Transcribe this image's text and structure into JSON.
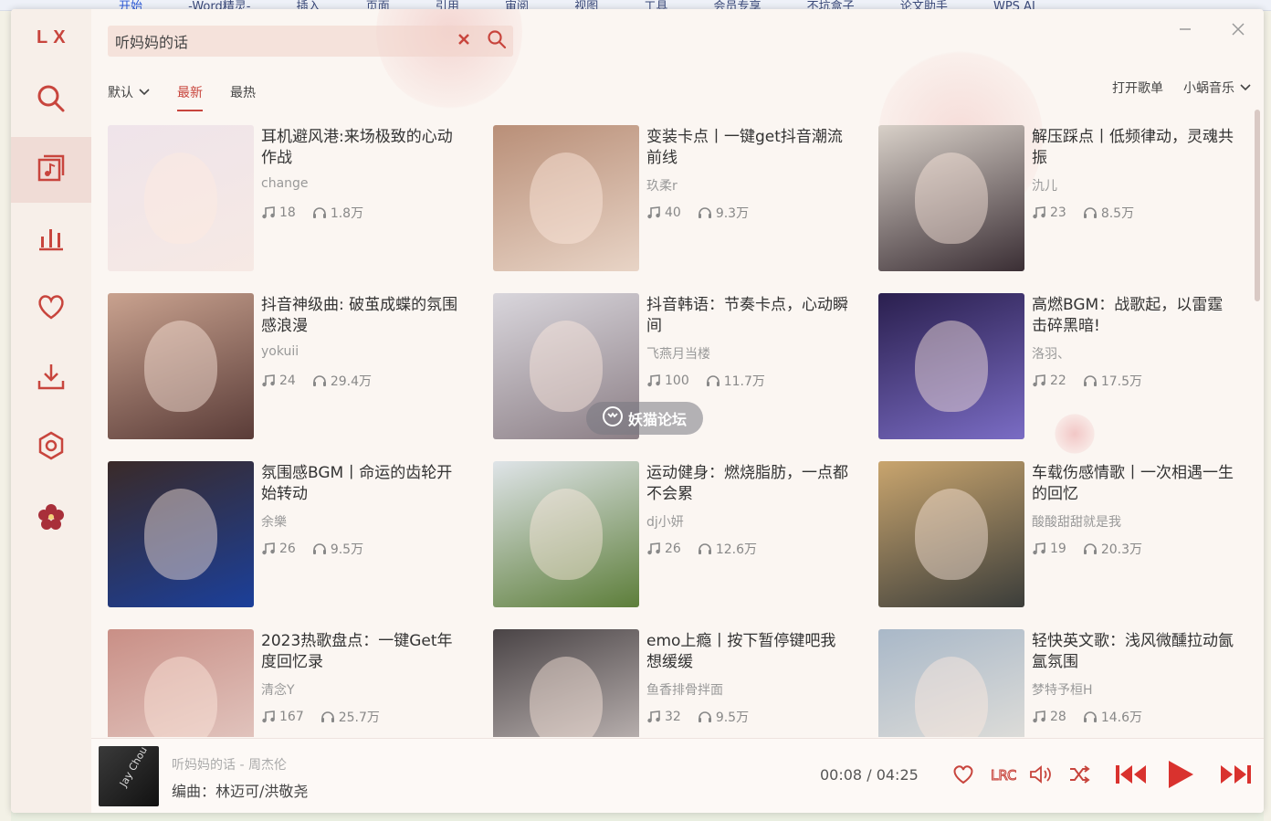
{
  "background_doc": {
    "menu": [
      "开始",
      "-Word精灵-",
      "插入",
      "页面",
      "引用",
      "审阅",
      "视图",
      "工具",
      "会员专享",
      "不坑盒子",
      "论文助手",
      "WPS AI"
    ]
  },
  "app": {
    "logo": "LX",
    "accent": "#c8453d"
  },
  "sidebar": {
    "items": [
      {
        "icon": "search-icon",
        "label": "搜索"
      },
      {
        "icon": "songlist-icon",
        "label": "歌单"
      },
      {
        "icon": "leaderboard-icon",
        "label": "排行榜"
      },
      {
        "icon": "heart-icon",
        "label": "我的收藏"
      },
      {
        "icon": "download-icon",
        "label": "下载"
      },
      {
        "icon": "settings-icon",
        "label": "设置"
      }
    ]
  },
  "search": {
    "value": "听妈妈的话",
    "placeholder": "搜索"
  },
  "sort": {
    "default_label": "默认",
    "tabs": [
      "最新",
      "最热"
    ],
    "active": "最新"
  },
  "header": {
    "open_playlist": "打开歌单",
    "source": "小蜗音乐"
  },
  "playlists": [
    {
      "title": "耳机避风港:来场极致的心动作战",
      "author": "change",
      "songs": "18",
      "plays": "1.8万",
      "bg": [
        "#efe4ea",
        "#f6e9e4"
      ]
    },
    {
      "title": "变装卡点丨一键get抖音潮流前线",
      "author": "玖柔r",
      "songs": "40",
      "plays": "9.3万",
      "bg": [
        "#b98f78",
        "#e8d4c6"
      ]
    },
    {
      "title": "解压踩点丨低频律动，灵魂共振",
      "author": "氿儿",
      "songs": "23",
      "plays": "8.5万",
      "bg": [
        "#d8d0c8",
        "#3a2e34"
      ]
    },
    {
      "title": "抖音神级曲: 破茧成蝶的氛围感浪漫",
      "author": "yokuii",
      "songs": "24",
      "plays": "29.4万",
      "bg": [
        "#c9a28f",
        "#5a3c38"
      ]
    },
    {
      "title": "抖音韩语：节奏卡点，心动瞬间",
      "author": "飞燕月当楼",
      "songs": "100",
      "plays": "11.7万",
      "bg": [
        "#d9d6dc",
        "#8c7f86"
      ]
    },
    {
      "title": "高燃BGM：战歌起，以雷霆击碎黑暗!",
      "author": "洛羽、",
      "songs": "22",
      "plays": "17.5万",
      "bg": [
        "#2a1f4e",
        "#7a6cc4"
      ]
    },
    {
      "title": "氛围感BGM丨命运的齿轮开始转动",
      "author": "余樂",
      "songs": "26",
      "plays": "9.5万",
      "bg": [
        "#3a2a28",
        "#1b3f9a"
      ]
    },
    {
      "title": "运动健身：燃烧脂肪，一点都不会累",
      "author": "dj小妍",
      "songs": "26",
      "plays": "12.6万",
      "bg": [
        "#dfe4e8",
        "#5d7e3a"
      ]
    },
    {
      "title": "车载伤感情歌丨一次相遇一生的回忆",
      "author": "酸酸甜甜就是我",
      "songs": "19",
      "plays": "20.3万",
      "bg": [
        "#c9a56e",
        "#3b3d3a"
      ]
    },
    {
      "title": "2023热歌盘点：一键Get年度回忆录",
      "author": "清念Y",
      "songs": "167",
      "plays": "25.7万",
      "bg": [
        "#c98f86",
        "#e6cfc9"
      ]
    },
    {
      "title": "emo上瘾丨按下暂停键吧我想缓缓",
      "author": "鱼香排骨拌面",
      "songs": "32",
      "plays": "9.5万",
      "bg": [
        "#4a4446",
        "#cfc6c4"
      ]
    },
    {
      "title": "轻快英文歌：浅风微醺拉动氤氲氛围",
      "author": "梦特予桓H",
      "songs": "28",
      "plays": "14.6万",
      "bg": [
        "#a9b8c8",
        "#e8e4dc"
      ]
    }
  ],
  "watermark": "妖猫论坛",
  "player": {
    "title": "听妈妈的话 - 周杰伦",
    "lyric": "编曲：林迈可/洪敬尧",
    "current": "00:08",
    "separator": "/",
    "duration": "04:25",
    "cover_text": "Jay Chou",
    "progress": 0.03
  }
}
